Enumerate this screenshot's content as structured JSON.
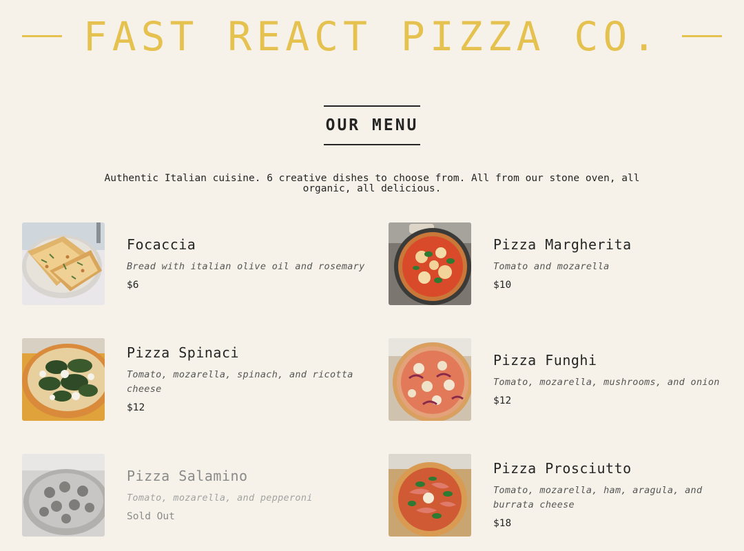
{
  "header": {
    "title": "FAST REACT PIZZA CO."
  },
  "menu": {
    "title": "OUR MENU",
    "intro": "Authentic Italian cuisine. 6 creative dishes to choose from. All from our stone oven, all organic, all delicious.",
    "items": [
      {
        "name": "Focaccia",
        "ingredients": "Bread with italian olive oil and rosemary",
        "price": "$6",
        "image_icon": "focaccia-photo"
      },
      {
        "name": "Pizza Margherita",
        "ingredients": "Tomato and mozarella",
        "price": "$10",
        "image_icon": "margherita-photo"
      },
      {
        "name": "Pizza Spinaci",
        "ingredients": "Tomato, mozarella, spinach, and ricotta cheese",
        "price": "$12",
        "image_icon": "spinaci-photo"
      },
      {
        "name": "Pizza Funghi",
        "ingredients": "Tomato, mozarella, mushrooms, and onion",
        "price": "$12",
        "image_icon": "funghi-photo"
      },
      {
        "name": "Pizza Salamino",
        "ingredients": "Tomato, mozarella, and pepperoni",
        "price": "Sold Out",
        "sold_out": true,
        "image_icon": "salamino-photo"
      },
      {
        "name": "Pizza Prosciutto",
        "ingredients": "Tomato, mozarella, ham, aragula, and burrata cheese",
        "price": "$18",
        "image_icon": "prosciutto-photo"
      }
    ]
  },
  "colors": {
    "background": "#f6f2e9",
    "accent": "#e5c14f",
    "text": "#252525"
  }
}
